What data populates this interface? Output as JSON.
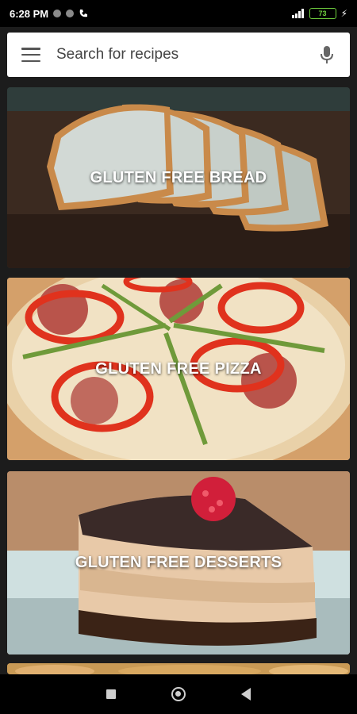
{
  "status_bar": {
    "time": "6:28 PM",
    "battery": "73"
  },
  "search": {
    "placeholder": "Search for recipes"
  },
  "cards": [
    {
      "label": "GLUTEN FREE BREAD"
    },
    {
      "label": "GLUTEN FREE PIZZA"
    },
    {
      "label": "GLUTEN FREE DESSERTS"
    }
  ],
  "icons": {
    "menu": "hamburger-menu-icon",
    "mic": "microphone-icon",
    "nav": [
      "recents-square-icon",
      "home-circle-icon",
      "back-triangle-icon"
    ]
  },
  "colors": {
    "background": "#1c1c1c",
    "search_bg": "#ffffff",
    "battery": "#6fcf3e"
  }
}
